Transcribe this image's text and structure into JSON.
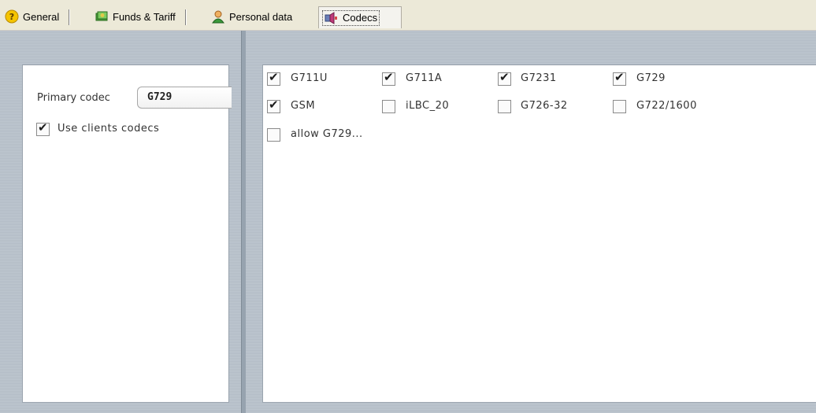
{
  "tabs": [
    {
      "label": "General",
      "icon": "question-icon"
    },
    {
      "label": "Funds & Tariff",
      "icon": "money-icon"
    },
    {
      "label": "Personal data",
      "icon": "user-icon"
    },
    {
      "label": "Codecs",
      "icon": "speaker-icon",
      "active": true
    }
  ],
  "left": {
    "primary_codec_label": "Primary codec",
    "primary_codec_value": "G729",
    "use_clients_codecs": {
      "label": "Use clients codecs",
      "checked": true
    }
  },
  "codecs": [
    {
      "label": "G711U",
      "checked": true
    },
    {
      "label": "G711A",
      "checked": true
    },
    {
      "label": "G7231",
      "checked": true
    },
    {
      "label": "G729",
      "checked": true
    },
    {
      "label": "GSM",
      "checked": true
    },
    {
      "label": "iLBC_20",
      "checked": false
    },
    {
      "label": "G726-32",
      "checked": false
    },
    {
      "label": "G722/1600",
      "checked": false
    },
    {
      "label": "allow G729...",
      "checked": false
    }
  ],
  "check_glyph": "✔",
  "colors": {
    "panel_bg": "#b9c2cc",
    "tab_strip": "#ece9d8"
  }
}
